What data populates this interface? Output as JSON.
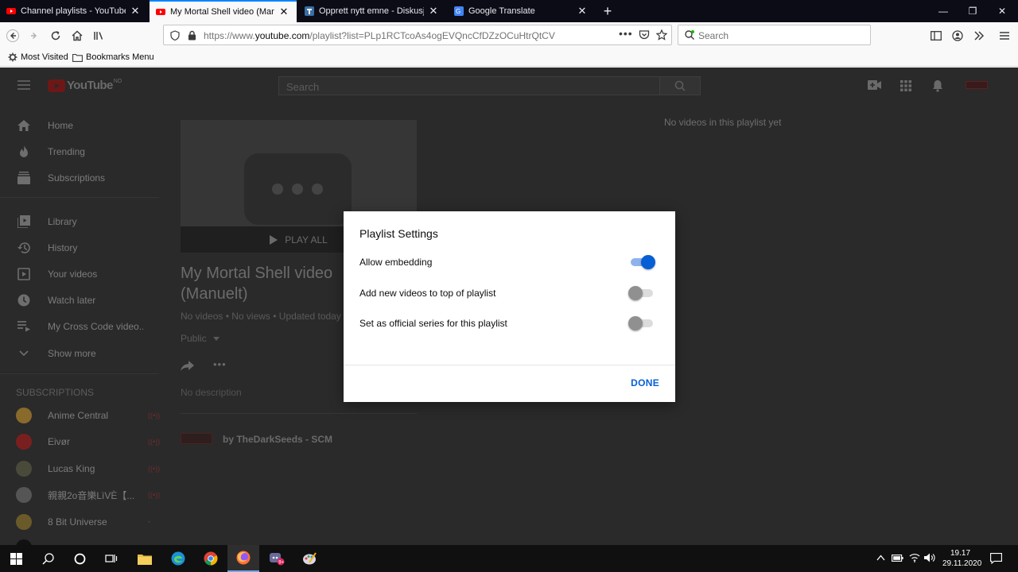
{
  "browser": {
    "tabs": [
      {
        "label": "Channel playlists - YouTube Stu",
        "active": false,
        "favicon": "youtube-icon"
      },
      {
        "label": "My Mortal Shell video (Manuelt",
        "active": true,
        "favicon": "youtube-icon"
      },
      {
        "label": "Opprett nytt emne - Diskusjon",
        "active": false,
        "favicon": "forum-icon"
      },
      {
        "label": "Google Translate",
        "active": false,
        "favicon": "translate-icon"
      }
    ],
    "url_prefix": "https://www.",
    "url_host": "youtube.com",
    "url_path": "/playlist?list=PLp1RCTcoAs4ogEVQncCfDZzOCuHtrQtCV",
    "search_placeholder": "Search",
    "bookmarks": [
      {
        "label": "Most Visited",
        "icon": "gear-icon"
      },
      {
        "label": "Bookmarks Menu",
        "icon": "folder-icon"
      }
    ]
  },
  "youtube": {
    "logo_text": "YouTube",
    "logo_region": "NO",
    "search_placeholder": "Search",
    "sidebar": {
      "primary": [
        {
          "label": "Home",
          "icon": "home-icon"
        },
        {
          "label": "Trending",
          "icon": "flame-icon"
        },
        {
          "label": "Subscriptions",
          "icon": "subscriptions-icon"
        }
      ],
      "secondary": [
        {
          "label": "Library",
          "icon": "library-icon"
        },
        {
          "label": "History",
          "icon": "history-icon"
        },
        {
          "label": "Your videos",
          "icon": "video-icon"
        },
        {
          "label": "Watch later",
          "icon": "clock-icon"
        },
        {
          "label": "My Cross Code video...",
          "icon": "playlist-icon"
        },
        {
          "label": "Show more",
          "icon": "chevron-down-icon"
        }
      ],
      "subscriptions_heading": "SUBSCRIPTIONS",
      "subscriptions": [
        {
          "label": "Anime Central",
          "live": true,
          "color": "#8a6a2a"
        },
        {
          "label": "Eivør",
          "live": true,
          "color": "#7a1f1f"
        },
        {
          "label": "Lucas King",
          "live": true,
          "color": "#4a4a3a"
        },
        {
          "label": "親親2o音樂LìVÈ【...",
          "live": true,
          "color": "#555555"
        },
        {
          "label": "8 Bit Universe",
          "live": false,
          "color": "#6a5a2a"
        }
      ]
    },
    "playlist": {
      "play_all": "PLAY ALL",
      "title": "My Mortal Shell video (Manuelt)",
      "meta": "No videos • No views • Updated today",
      "privacy": "Public",
      "description": "No description",
      "owner": "by TheDarkSeeds - SCM",
      "empty_message": "No videos in this playlist yet"
    }
  },
  "dialog": {
    "title": "Playlist Settings",
    "rows": [
      {
        "label": "Allow embedding",
        "enabled": true
      },
      {
        "label": "Add new videos to top of playlist",
        "enabled": false
      },
      {
        "label": "Set as official series for this playlist",
        "enabled": false
      }
    ],
    "done_label": "DONE",
    "accent_color": "#065fd4"
  },
  "taskbar": {
    "time": "19.17",
    "date": "29.11.2020"
  }
}
